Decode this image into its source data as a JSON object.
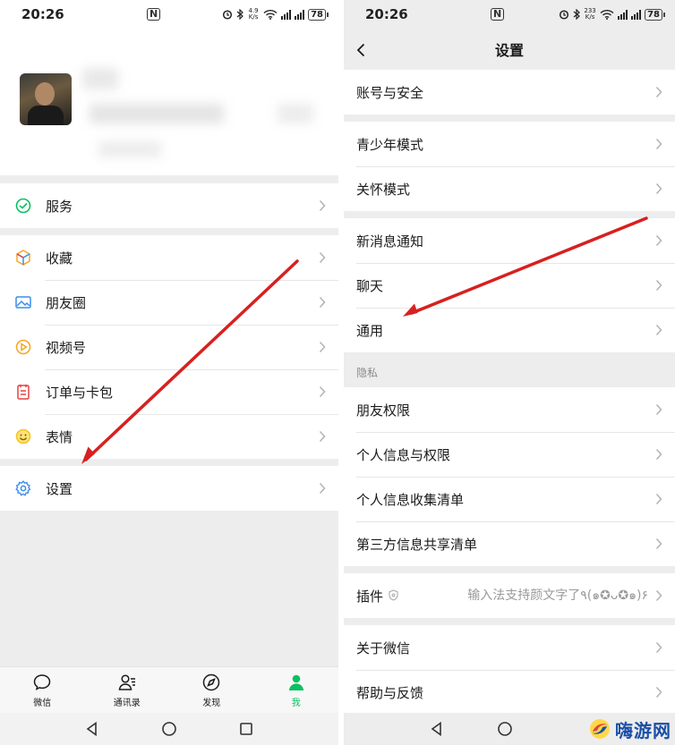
{
  "status_bar": {
    "time": "20:26",
    "nfc": "N",
    "left_speed_value": "4.9",
    "right_speed_value": "233",
    "speed_unit": "K/s",
    "battery": "78"
  },
  "me_page": {
    "items_group1": [
      {
        "label": "服务",
        "icon": "wechat-pay-service-icon"
      }
    ],
    "items_group2": [
      {
        "label": "收藏",
        "icon": "favorites-cube-icon"
      },
      {
        "label": "朋友圈",
        "icon": "moments-picture-icon"
      },
      {
        "label": "视频号",
        "icon": "channels-play-icon"
      },
      {
        "label": "订单与卡包",
        "icon": "orders-cards-icon"
      },
      {
        "label": "表情",
        "icon": "stickers-smile-icon"
      }
    ],
    "items_group3": [
      {
        "label": "设置",
        "icon": "settings-gear-icon"
      }
    ],
    "tabs": [
      {
        "label": "微信",
        "icon": "chat-bubble-icon"
      },
      {
        "label": "通讯录",
        "icon": "contacts-icon"
      },
      {
        "label": "发现",
        "icon": "discover-compass-icon"
      },
      {
        "label": "我",
        "icon": "me-person-icon",
        "active": true
      }
    ]
  },
  "settings_page": {
    "title": "设置",
    "group1": [
      {
        "label": "账号与安全"
      }
    ],
    "group2": [
      {
        "label": "青少年模式"
      },
      {
        "label": "关怀模式"
      }
    ],
    "group3": [
      {
        "label": "新消息通知"
      },
      {
        "label": "聊天"
      },
      {
        "label": "通用"
      }
    ],
    "privacy_section_label": "隐私",
    "group4": [
      {
        "label": "朋友权限"
      },
      {
        "label": "个人信息与权限"
      },
      {
        "label": "个人信息收集清单"
      },
      {
        "label": "第三方信息共享清单"
      }
    ],
    "plugins": {
      "label": "插件",
      "value": "输入法支持颜文字了٩(๑✪ᴗ✪๑)۶"
    },
    "group6": [
      {
        "label": "关于微信"
      },
      {
        "label": "帮助与反馈"
      }
    ]
  },
  "watermark": {
    "text": "嗨游网"
  },
  "colors": {
    "accent_green": "#07c160",
    "arrow_red": "#d82020",
    "background": "#ededed"
  }
}
